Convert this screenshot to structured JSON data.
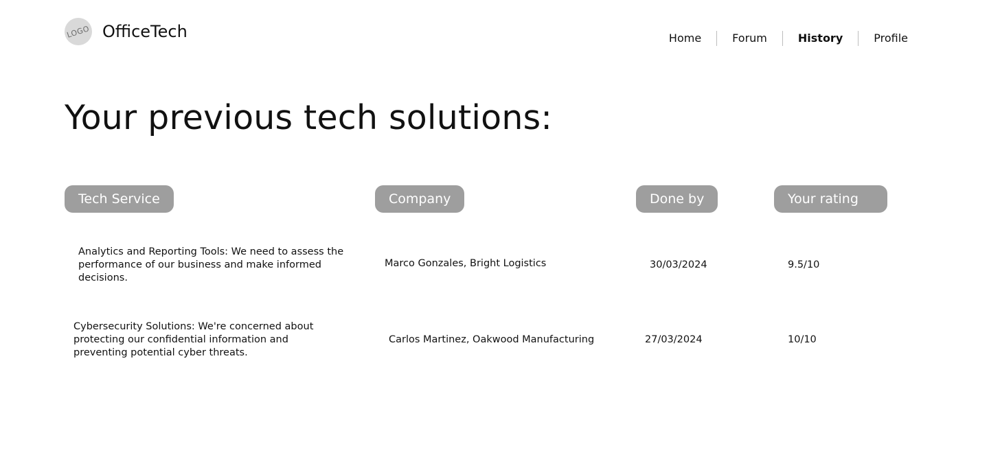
{
  "header": {
    "logo_text": "LOGO",
    "brand": "OfficeTech",
    "nav": [
      {
        "label": "Home",
        "active": false
      },
      {
        "label": "Forum",
        "active": false
      },
      {
        "label": "History",
        "active": true
      },
      {
        "label": "Profile",
        "active": false
      }
    ]
  },
  "main": {
    "title": "Your previous tech solutions:",
    "columns": [
      "Tech Service",
      "Company",
      "Done by",
      "Your rating"
    ],
    "rows": [
      {
        "service": "Analytics and Reporting Tools: We need to assess the performance of our business and make informed decisions.",
        "company": "Marco Gonzales, Bright Logistics",
        "done_by": "30/03/2024",
        "rating": "9.5/10"
      },
      {
        "service": "Cybersecurity Solutions: We're concerned about protecting our confidential information and preventing potential cyber threats.",
        "company": "Carlos Martinez, Oakwood Manufacturing",
        "done_by": "27/03/2024",
        "rating": "10/10"
      }
    ]
  },
  "colors": {
    "pill_bg": "#9e9e9e",
    "pill_text": "#ffffff",
    "logo_bg": "#d9d9d9",
    "separator": "#bdbdbd"
  }
}
